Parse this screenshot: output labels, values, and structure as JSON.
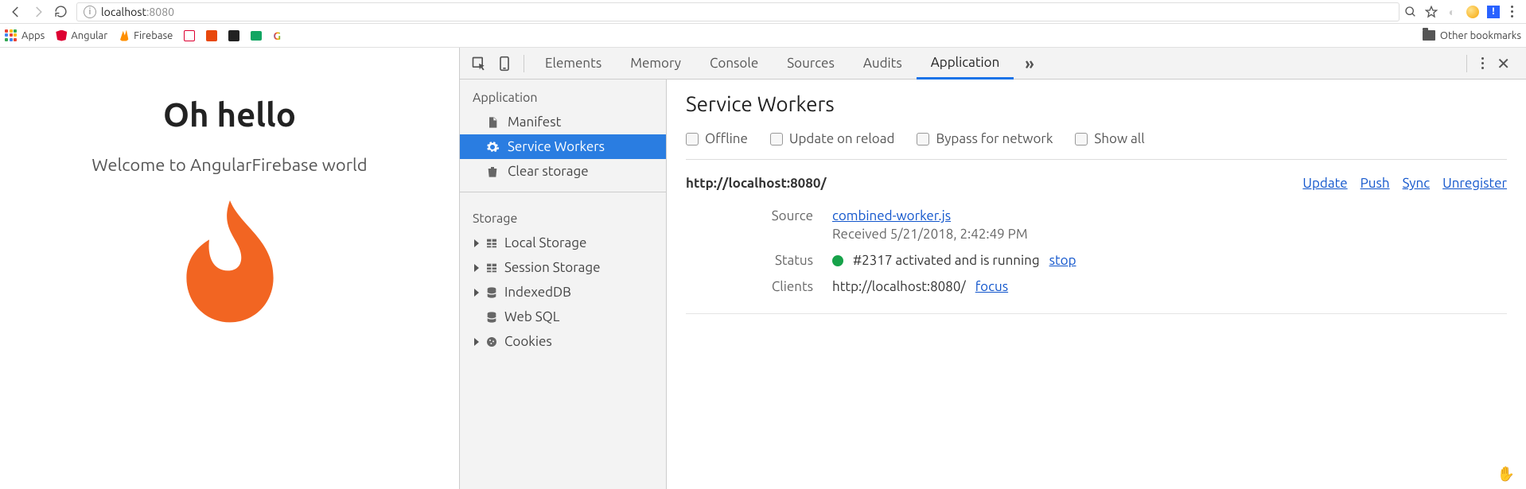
{
  "browser": {
    "address_host": "localhost",
    "address_port": ":8080",
    "other_bookmarks": "Other bookmarks",
    "bookmarks": {
      "apps": "Apps",
      "angular": "Angular",
      "firebase": "Firebase"
    }
  },
  "page": {
    "title": "Oh hello",
    "subtitle": "Welcome to AngularFirebase world"
  },
  "devtools": {
    "tabs": [
      "Elements",
      "Memory",
      "Console",
      "Sources",
      "Audits",
      "Application"
    ],
    "active_tab": "Application",
    "sidebar": {
      "section_app": "Application",
      "items_app": [
        "Manifest",
        "Service Workers",
        "Clear storage"
      ],
      "selected": "Service Workers",
      "section_storage": "Storage",
      "items_storage": [
        "Local Storage",
        "Session Storage",
        "IndexedDB",
        "Web SQL",
        "Cookies"
      ]
    },
    "panel": {
      "title": "Service Workers",
      "options": [
        "Offline",
        "Update on reload",
        "Bypass for network",
        "Show all"
      ],
      "sw": {
        "scope": "http://localhost:8080/",
        "actions": [
          "Update",
          "Push",
          "Sync",
          "Unregister"
        ],
        "rows": {
          "source_label": "Source",
          "source_file": "combined-worker.js",
          "source_received": "Received 5/21/2018, 2:42:49 PM",
          "status_label": "Status",
          "status_text": "#2317 activated and is running",
          "status_action": "stop",
          "clients_label": "Clients",
          "clients_url": "http://localhost:8080/",
          "clients_action": "focus"
        }
      }
    }
  }
}
